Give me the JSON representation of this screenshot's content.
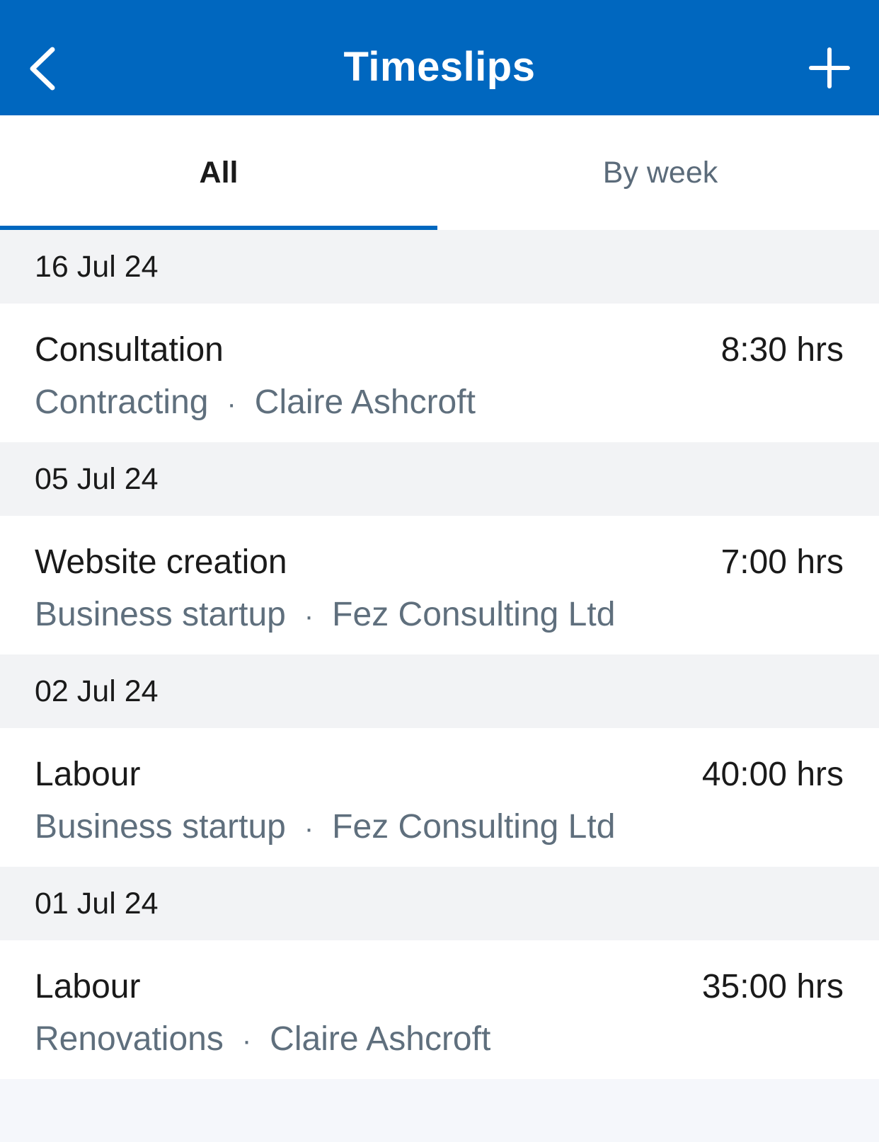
{
  "header": {
    "title": "Timeslips",
    "back_icon": "chevron-left-icon",
    "add_icon": "plus-icon",
    "background_color": "#0067bf"
  },
  "tabs": [
    {
      "label": "All",
      "selected": true
    },
    {
      "label": "By week",
      "selected": false
    }
  ],
  "groups": [
    {
      "date": "16 Jul 24",
      "entries": [
        {
          "task": "Consultation",
          "hours": "8:30 hrs",
          "project": "Contracting",
          "separator": "·",
          "client": "Claire Ashcroft"
        }
      ]
    },
    {
      "date": "05 Jul 24",
      "entries": [
        {
          "task": "Website creation",
          "hours": "7:00 hrs",
          "project": "Business startup",
          "separator": "·",
          "client": "Fez Consulting Ltd"
        }
      ]
    },
    {
      "date": "02 Jul 24",
      "entries": [
        {
          "task": "Labour",
          "hours": "40:00 hrs",
          "project": "Business startup",
          "separator": "·",
          "client": "Fez Consulting Ltd"
        }
      ]
    },
    {
      "date": "01 Jul 24",
      "entries": [
        {
          "task": "Labour",
          "hours": "35:00 hrs",
          "project": "Renovations",
          "separator": "·",
          "client": "Claire Ashcroft"
        }
      ]
    }
  ]
}
